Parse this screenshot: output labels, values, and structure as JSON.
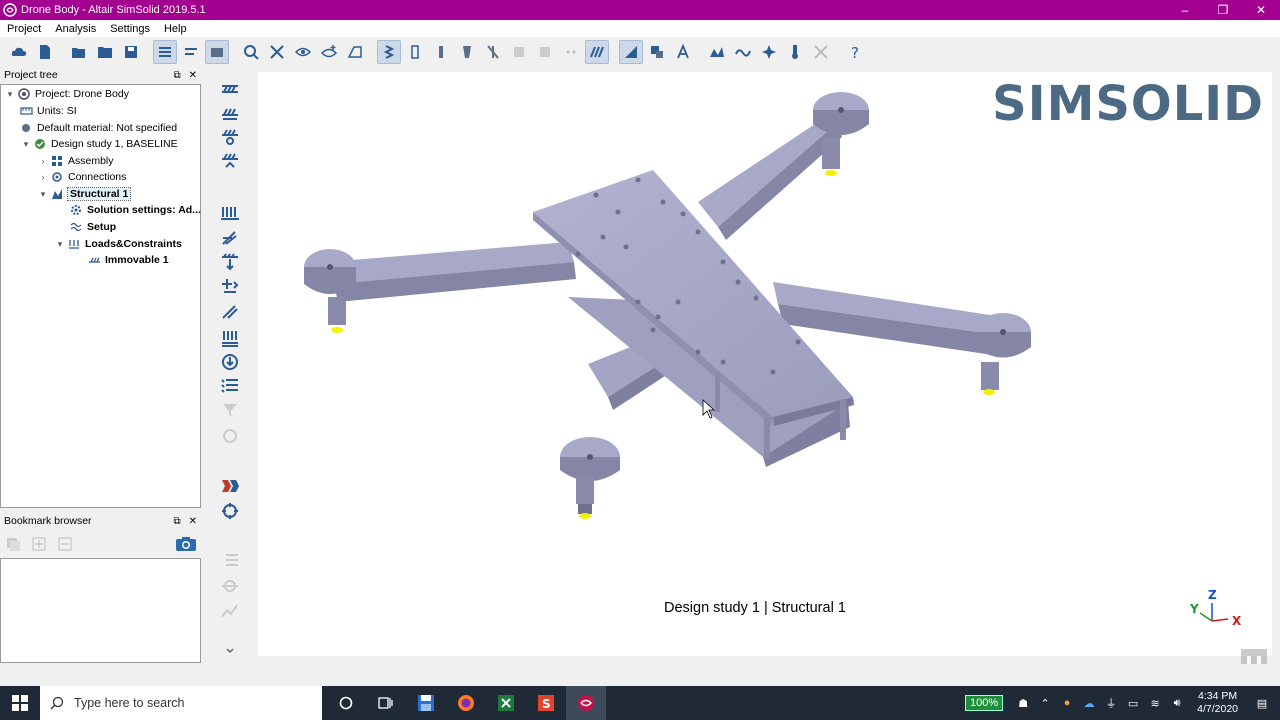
{
  "window": {
    "title": "Drone Body - Altair SimSolid 2019.5.1",
    "controls": [
      "–",
      "❐",
      "✕"
    ]
  },
  "menu": [
    "Project",
    "Analysis",
    "Settings",
    "Help"
  ],
  "project_tree": {
    "header": "Project tree",
    "items": [
      {
        "label": "Project: Drone Body",
        "icon": "project-icon"
      },
      {
        "label": "Units: SI",
        "icon": "units-icon"
      },
      {
        "label": "Default material: Not specified",
        "icon": "material-icon"
      },
      {
        "label": "Design study 1, BASELINE",
        "icon": "design-study-icon"
      },
      {
        "label": "Assembly",
        "icon": "assembly-icon"
      },
      {
        "label": "Connections",
        "icon": "connections-icon"
      },
      {
        "label": "Structural  1",
        "icon": "structural-icon"
      },
      {
        "label": "Solution settings: Ad...",
        "icon": "gear-icon"
      },
      {
        "label": "Setup",
        "icon": "setup-icon"
      },
      {
        "label": "Loads&Constraints",
        "icon": "loads-icon"
      },
      {
        "label": "Immovable 1",
        "icon": "immovable-icon"
      }
    ]
  },
  "bookmark_browser": {
    "header": "Bookmark browser"
  },
  "viewport": {
    "logo": "SIMSOLID",
    "caption": "Design study 1 | Structural  1",
    "triad": {
      "y": "Y",
      "z": "Z",
      "x": "X"
    }
  },
  "taskbar": {
    "search_placeholder": "Type here to search",
    "battery": "100%",
    "time": "4:34 PM",
    "date": "4/7/2020"
  },
  "colors": {
    "titlebar": "#a4008f",
    "model": "#a3a4c4",
    "logo": "#4d6a85",
    "accent": "#2b6cb0"
  }
}
